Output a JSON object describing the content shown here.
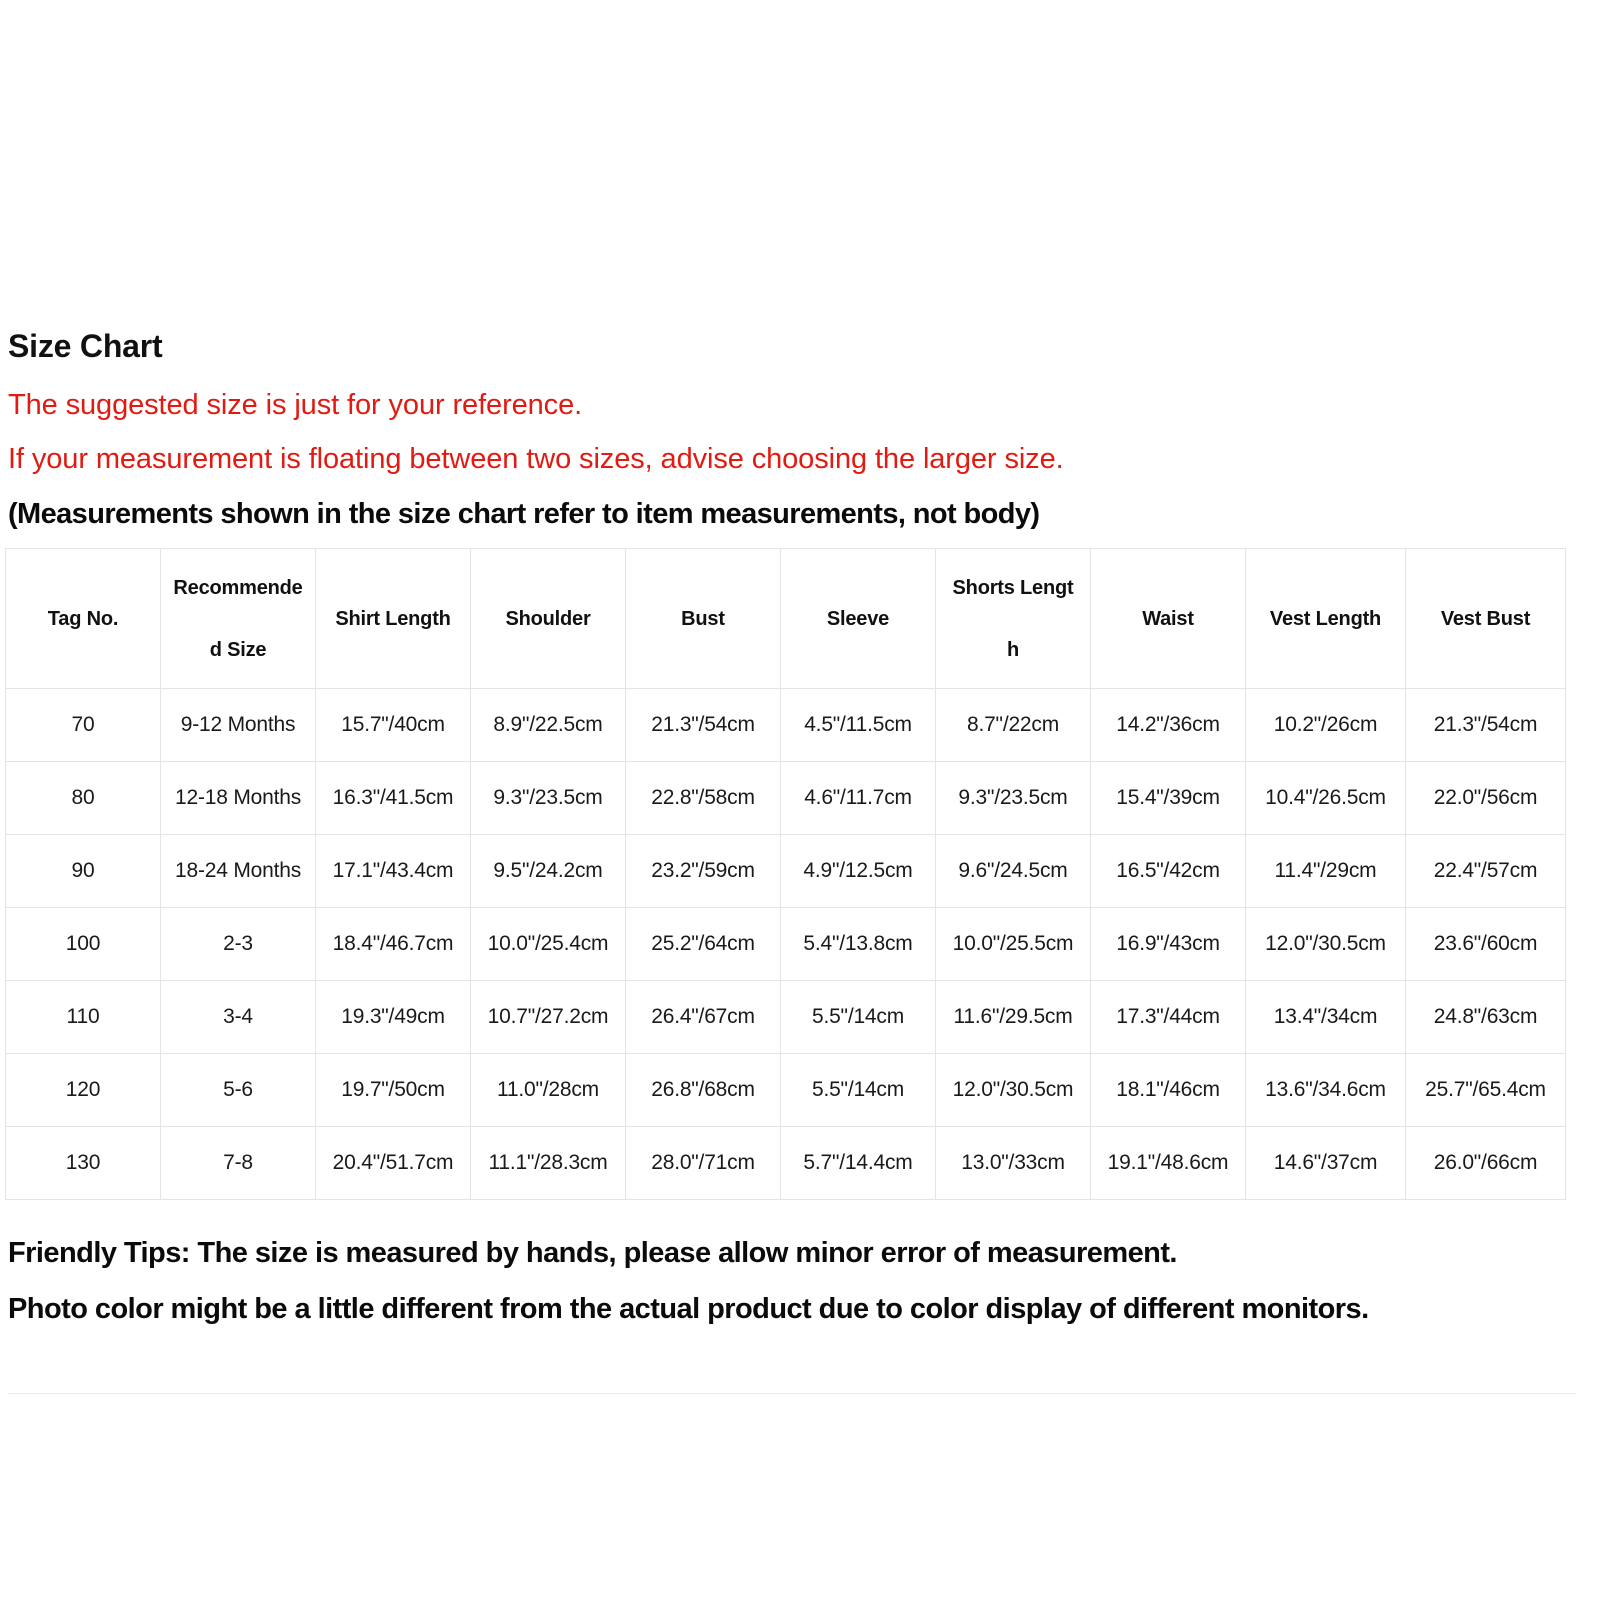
{
  "document": {
    "title": "Size Chart",
    "notes": [
      "The suggested size is just for your reference.",
      "If your measurement is floating between two sizes, advise choosing the larger size."
    ],
    "measurement_note": "(Measurements shown in the size chart refer to item measurements, not body)",
    "footer": {
      "tip_line_1": "Friendly Tips: The size is measured by hands, please allow minor error of measurement.",
      "tip_line_2": "Photo color might be a little different from the actual product due to color display of different monitors."
    },
    "colors": {
      "note_red": "#e01b12",
      "text_black": "#111111",
      "table_border": "#e4e4e4"
    }
  },
  "chart_data": {
    "type": "table",
    "title": "Size Chart",
    "columns": [
      {
        "label": "Tag No.",
        "line1": "Tag No.",
        "line2": ""
      },
      {
        "label": "Recommended Size",
        "line1": "Recommende",
        "line2": "d Size"
      },
      {
        "label": "Shirt Length",
        "line1": "Shirt Length",
        "line2": ""
      },
      {
        "label": "Shoulder",
        "line1": "Shoulder",
        "line2": ""
      },
      {
        "label": "Bust",
        "line1": "Bust",
        "line2": ""
      },
      {
        "label": "Sleeve",
        "line1": "Sleeve",
        "line2": ""
      },
      {
        "label": "Shorts Length",
        "line1": "Shorts Lengt",
        "line2": "h"
      },
      {
        "label": "Waist",
        "line1": "Waist",
        "line2": ""
      },
      {
        "label": "Vest Length",
        "line1": "Vest Length",
        "line2": ""
      },
      {
        "label": "Vest Bust",
        "line1": "Vest Bust",
        "line2": ""
      }
    ],
    "rows": [
      {
        "tag_no": "70",
        "recommended_size": "9-12 Months",
        "shirt_length": "15.7\"/40cm",
        "shoulder": "8.9\"/22.5cm",
        "bust": "21.3\"/54cm",
        "sleeve": "4.5\"/11.5cm",
        "shorts_length": "8.7\"/22cm",
        "waist": "14.2\"/36cm",
        "vest_length": "10.2\"/26cm",
        "vest_bust": "21.3\"/54cm"
      },
      {
        "tag_no": "80",
        "recommended_size": "12-18 Months",
        "shirt_length": "16.3\"/41.5cm",
        "shoulder": "9.3\"/23.5cm",
        "bust": "22.8\"/58cm",
        "sleeve": "4.6\"/11.7cm",
        "shorts_length": "9.3\"/23.5cm",
        "waist": "15.4\"/39cm",
        "vest_length": "10.4\"/26.5cm",
        "vest_bust": "22.0\"/56cm"
      },
      {
        "tag_no": "90",
        "recommended_size": "18-24 Months",
        "shirt_length": "17.1\"/43.4cm",
        "shoulder": "9.5\"/24.2cm",
        "bust": "23.2\"/59cm",
        "sleeve": "4.9\"/12.5cm",
        "shorts_length": "9.6\"/24.5cm",
        "waist": "16.5\"/42cm",
        "vest_length": "11.4\"/29cm",
        "vest_bust": "22.4\"/57cm"
      },
      {
        "tag_no": "100",
        "recommended_size": "2-3",
        "shirt_length": "18.4\"/46.7cm",
        "shoulder": "10.0\"/25.4cm",
        "bust": "25.2\"/64cm",
        "sleeve": "5.4\"/13.8cm",
        "shorts_length": "10.0\"/25.5cm",
        "waist": "16.9\"/43cm",
        "vest_length": "12.0\"/30.5cm",
        "vest_bust": "23.6\"/60cm"
      },
      {
        "tag_no": "110",
        "recommended_size": "3-4",
        "shirt_length": "19.3\"/49cm",
        "shoulder": "10.7\"/27.2cm",
        "bust": "26.4\"/67cm",
        "sleeve": "5.5\"/14cm",
        "shorts_length": "11.6\"/29.5cm",
        "waist": "17.3\"/44cm",
        "vest_length": "13.4\"/34cm",
        "vest_bust": "24.8\"/63cm"
      },
      {
        "tag_no": "120",
        "recommended_size": "5-6",
        "shirt_length": "19.7\"/50cm",
        "shoulder": "11.0\"/28cm",
        "bust": "26.8\"/68cm",
        "sleeve": "5.5\"/14cm",
        "shorts_length": "12.0\"/30.5cm",
        "waist": "18.1\"/46cm",
        "vest_length": "13.6\"/34.6cm",
        "vest_bust": "25.7\"/65.4cm"
      },
      {
        "tag_no": "130",
        "recommended_size": "7-8",
        "shirt_length": "20.4\"/51.7cm",
        "shoulder": "11.1\"/28.3cm",
        "bust": "28.0\"/71cm",
        "sleeve": "5.7\"/14.4cm",
        "shorts_length": "13.0\"/33cm",
        "waist": "19.1\"/48.6cm",
        "vest_length": "14.6\"/37cm",
        "vest_bust": "26.0\"/66cm"
      }
    ]
  }
}
